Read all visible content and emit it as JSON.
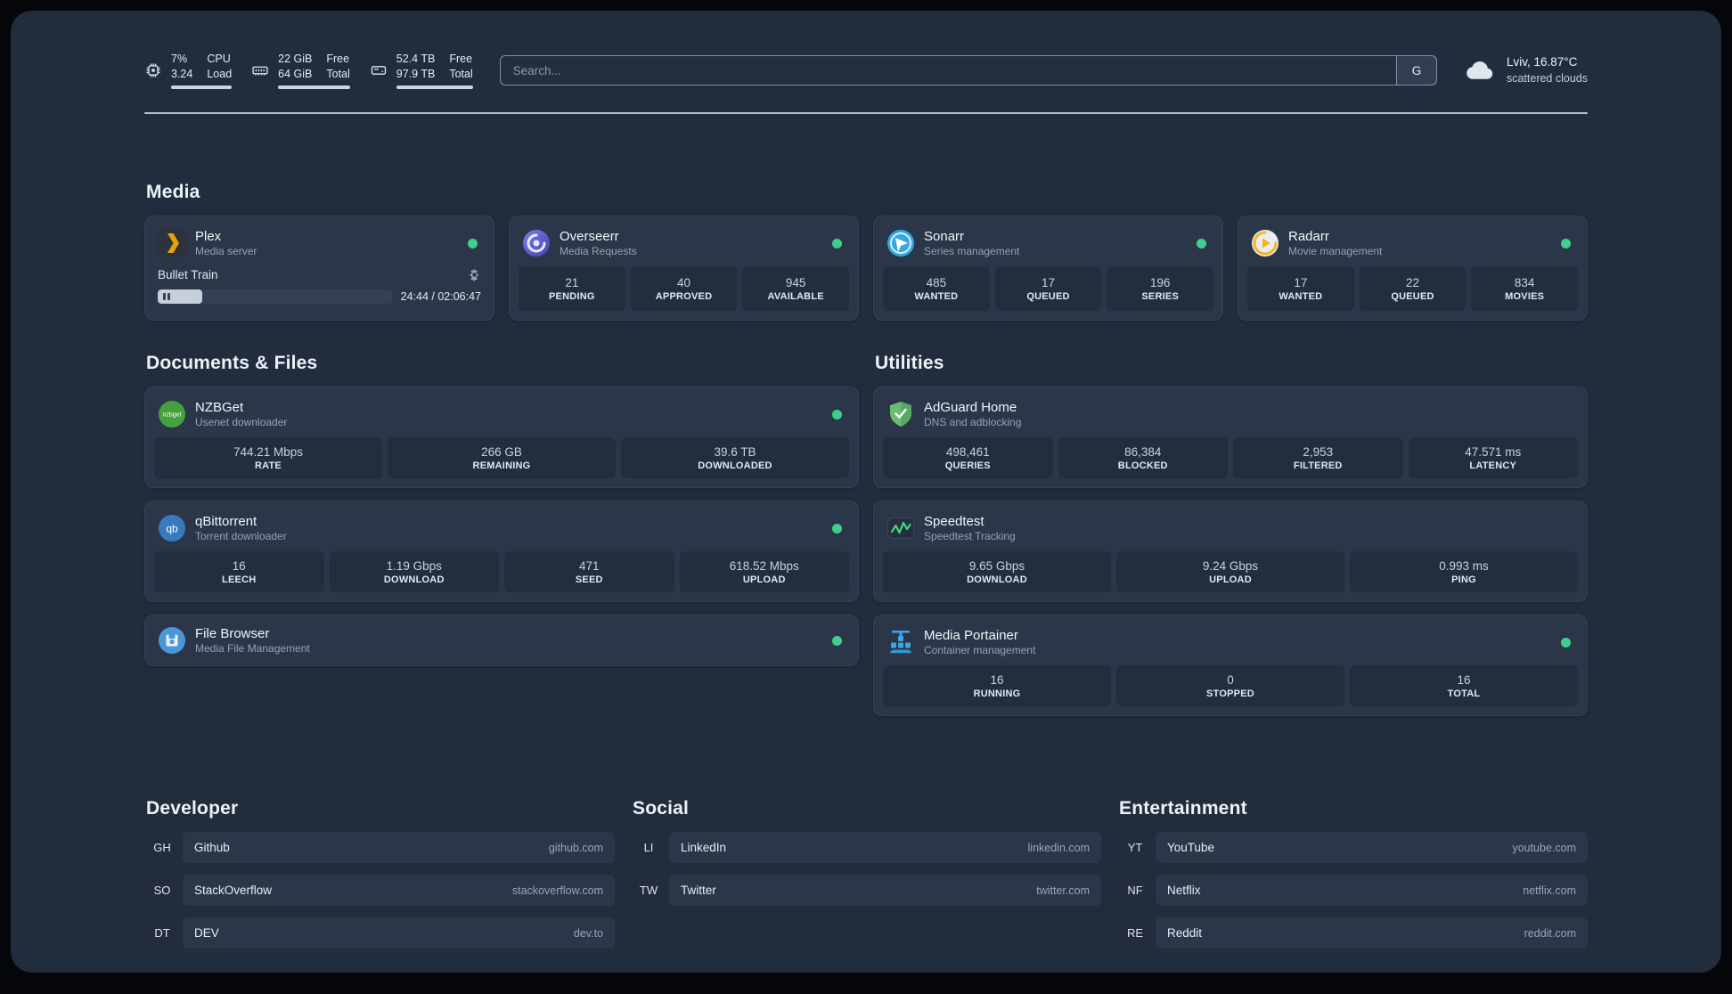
{
  "topbar": {
    "resources": [
      {
        "icon": "cpu-icon",
        "value_top": "7%",
        "value_bottom": "3.24",
        "label_top": "CPU",
        "label_bottom": "Load"
      },
      {
        "icon": "memory-icon",
        "value_top": "22 GiB",
        "value_bottom": "64 GiB",
        "label_top": "Free",
        "label_bottom": "Total"
      },
      {
        "icon": "disk-icon",
        "value_top": "52.4 TB",
        "value_bottom": "97.9 TB",
        "label_top": "Free",
        "label_bottom": "Total"
      }
    ],
    "search": {
      "placeholder": "Search...",
      "provider_label": "G"
    },
    "weather": {
      "location": "Lviv, 16.87°C",
      "condition": "scattered clouds"
    }
  },
  "media": {
    "title": "Media",
    "plex": {
      "name": "Plex",
      "subtitle": "Media server",
      "status": "online",
      "player": {
        "title": "Bullet Train",
        "time": "24:44 / 02:06:47",
        "progress_pct": 19
      }
    },
    "overseerr": {
      "name": "Overseerr",
      "subtitle": "Media Requests",
      "status": "online",
      "stats": [
        {
          "value": "21",
          "label": "PENDING"
        },
        {
          "value": "40",
          "label": "APPROVED"
        },
        {
          "value": "945",
          "label": "AVAILABLE"
        }
      ]
    },
    "sonarr": {
      "name": "Sonarr",
      "subtitle": "Series management",
      "status": "online",
      "stats": [
        {
          "value": "485",
          "label": "WANTED"
        },
        {
          "value": "17",
          "label": "QUEUED"
        },
        {
          "value": "196",
          "label": "SERIES"
        }
      ]
    },
    "radarr": {
      "name": "Radarr",
      "subtitle": "Movie management",
      "status": "online",
      "stats": [
        {
          "value": "17",
          "label": "WANTED"
        },
        {
          "value": "22",
          "label": "QUEUED"
        },
        {
          "value": "834",
          "label": "MOVIES"
        }
      ]
    }
  },
  "files": {
    "title": "Documents & Files",
    "nzbget": {
      "name": "NZBGet",
      "subtitle": "Usenet downloader",
      "status": "online",
      "stats": [
        {
          "value": "744.21 Mbps",
          "label": "RATE"
        },
        {
          "value": "266 GB",
          "label": "REMAINING"
        },
        {
          "value": "39.6 TB",
          "label": "DOWNLOADED"
        }
      ]
    },
    "qbittorrent": {
      "name": "qBittorrent",
      "subtitle": "Torrent downloader",
      "status": "online",
      "stats": [
        {
          "value": "16",
          "label": "LEECH"
        },
        {
          "value": "1.19 Gbps",
          "label": "DOWNLOAD"
        },
        {
          "value": "471",
          "label": "SEED"
        },
        {
          "value": "618.52 Mbps",
          "label": "UPLOAD"
        }
      ]
    },
    "filebrowser": {
      "name": "File Browser",
      "subtitle": "Media File Management",
      "status": "online"
    }
  },
  "utilities": {
    "title": "Utilities",
    "adguard": {
      "name": "AdGuard Home",
      "subtitle": "DNS and adblocking",
      "stats": [
        {
          "value": "498,461",
          "label": "QUERIES"
        },
        {
          "value": "86,384",
          "label": "BLOCKED"
        },
        {
          "value": "2,953",
          "label": "FILTERED"
        },
        {
          "value": "47.571 ms",
          "label": "LATENCY"
        }
      ]
    },
    "speedtest": {
      "name": "Speedtest",
      "subtitle": "Speedtest Tracking",
      "stats": [
        {
          "value": "9.65 Gbps",
          "label": "DOWNLOAD"
        },
        {
          "value": "9.24 Gbps",
          "label": "UPLOAD"
        },
        {
          "value": "0.993 ms",
          "label": "PING"
        }
      ]
    },
    "portainer": {
      "name": "Media Portainer",
      "subtitle": "Container management",
      "status": "online",
      "stats": [
        {
          "value": "16",
          "label": "RUNNING"
        },
        {
          "value": "0",
          "label": "STOPPED"
        },
        {
          "value": "16",
          "label": "TOTAL"
        }
      ]
    }
  },
  "bookmarks": {
    "developer": {
      "title": "Developer",
      "items": [
        {
          "abbr": "GH",
          "name": "Github",
          "url": "github.com"
        },
        {
          "abbr": "SO",
          "name": "StackOverflow",
          "url": "stackoverflow.com"
        },
        {
          "abbr": "DT",
          "name": "DEV",
          "url": "dev.to"
        }
      ]
    },
    "social": {
      "title": "Social",
      "items": [
        {
          "abbr": "LI",
          "name": "LinkedIn",
          "url": "linkedin.com"
        },
        {
          "abbr": "TW",
          "name": "Twitter",
          "url": "twitter.com"
        }
      ]
    },
    "entertainment": {
      "title": "Entertainment",
      "items": [
        {
          "abbr": "YT",
          "name": "YouTube",
          "url": "youtube.com"
        },
        {
          "abbr": "NF",
          "name": "Netflix",
          "url": "netflix.com"
        },
        {
          "abbr": "RE",
          "name": "Reddit",
          "url": "reddit.com"
        }
      ]
    }
  },
  "colors": {
    "status_online": "#3ecf8e",
    "plex_accent": "#e5a00d",
    "background": "#212c3d",
    "card": "#2b3649"
  }
}
